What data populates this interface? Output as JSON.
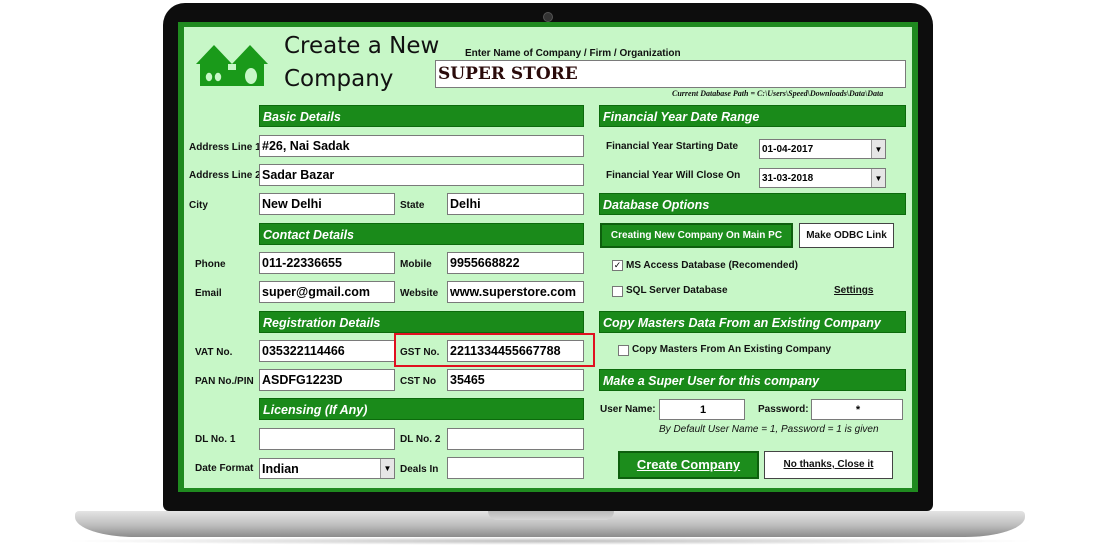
{
  "header": {
    "title_line1": "Create a New",
    "title_line2": "Company",
    "company_prompt": "Enter Name of Company / Firm / Organization",
    "company_name": "SUPER STORE",
    "db_path": "Current Database Path = C:\\Users\\Speed\\Downloads\\Data\\Data"
  },
  "sections": {
    "basic": "Basic Details",
    "contact": "Contact Details",
    "registration": "Registration Details",
    "licensing": "Licensing (If Any)",
    "fy": "Financial Year Date Range",
    "db": "Database Options",
    "copy": "Copy Masters Data From an Existing Company",
    "superuser": "Make a Super User for this company"
  },
  "basic": {
    "addr1_label": "Address Line 1",
    "addr1": "#26, Nai Sadak",
    "addr2_label": "Address Line 2",
    "addr2": "Sadar Bazar",
    "city_label": "City",
    "city": "New Delhi",
    "state_label": "State",
    "state": "Delhi"
  },
  "contact": {
    "phone_label": "Phone",
    "phone": "011-22336655",
    "mobile_label": "Mobile",
    "mobile": "9955668822",
    "email_label": "Email",
    "email": "super@gmail.com",
    "website_label": "Website",
    "website": "www.superstore.com"
  },
  "registration": {
    "vat_label": "VAT No.",
    "vat": "035322114466",
    "gst_label": "GST No.",
    "gst": "2211334455667788",
    "pan_label": "PAN No./PIN",
    "pan": "ASDFG1223D",
    "cst_label": "CST No",
    "cst": "35465"
  },
  "licensing": {
    "dl1_label": "DL No. 1",
    "dl1": "",
    "dl2_label": "DL No. 2",
    "dl2": "",
    "date_format_label": "Date Format",
    "date_format": "Indian",
    "deals_label": "Deals In",
    "deals": ""
  },
  "fy": {
    "start_label": "Financial Year Starting Date",
    "start": "01-04-2017",
    "end_label": "Financial Year Will Close On",
    "end": "31-03-2018"
  },
  "db": {
    "create_main_pc": "Creating New Company On Main PC",
    "odbc_link": "Make ODBC Link",
    "ms_access_checked": true,
    "ms_access_label": "MS Access Database   (Recomended)",
    "sql_server_checked": false,
    "sql_server_label": "SQL Server Database",
    "settings": "Settings"
  },
  "copy": {
    "checked": false,
    "label": "Copy Masters From An Existing Company"
  },
  "superuser": {
    "user_label": "User Name:",
    "user": "1",
    "pass_label": "Password:",
    "pass": "*",
    "hint": "By Default User Name = 1,  Password = 1 is given"
  },
  "actions": {
    "create": "Create Company",
    "close": "No thanks, Close it"
  },
  "colors": {
    "app_bg": "#c7f7c7",
    "section_bg": "#1a8a1a",
    "highlight": "#e0101f"
  },
  "icons": {
    "logo": "houses-logo-icon",
    "dropdown": "chevron-down-icon",
    "check": "check-icon"
  }
}
